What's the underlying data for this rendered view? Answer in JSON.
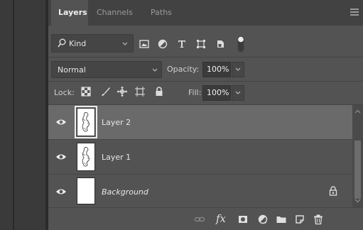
{
  "tabs": [
    {
      "label": "Layers",
      "active": true
    },
    {
      "label": "Channels",
      "active": false
    },
    {
      "label": "Paths",
      "active": false
    }
  ],
  "filter": {
    "kind_label": "Kind",
    "icons": [
      "image-filter-icon",
      "adjustment-filter-icon",
      "type-filter-icon",
      "shape-filter-icon",
      "smart-object-filter-icon",
      "filter-toggle-icon"
    ]
  },
  "blend": {
    "mode": "Normal",
    "opacity_label": "Opacity:",
    "opacity_value": "100%"
  },
  "lock": {
    "label": "Lock:",
    "icons": [
      "lock-transparent-pixels-icon",
      "lock-image-pixels-icon",
      "lock-position-icon",
      "lock-artboard-icon",
      "lock-all-icon"
    ],
    "fill_label": "Fill:",
    "fill_value": "100%"
  },
  "layers": [
    {
      "name": "Layer 2",
      "selected": true,
      "visible": true,
      "italic": false,
      "locked": false
    },
    {
      "name": "Layer 1",
      "selected": false,
      "visible": true,
      "italic": false,
      "locked": false
    },
    {
      "name": "Background",
      "selected": false,
      "visible": true,
      "italic": true,
      "locked": true
    }
  ],
  "bottom_toolbar": {
    "icons": [
      "link-layers-icon",
      "layer-style-fx-icon",
      "add-mask-icon",
      "adjustment-layer-icon",
      "new-group-icon",
      "new-layer-icon",
      "delete-layer-icon"
    ],
    "fx_label": "fx"
  },
  "colors": {
    "panel_bg": "#535353",
    "selected_row": "#6a6a6a",
    "tab_bar": "#424242"
  }
}
